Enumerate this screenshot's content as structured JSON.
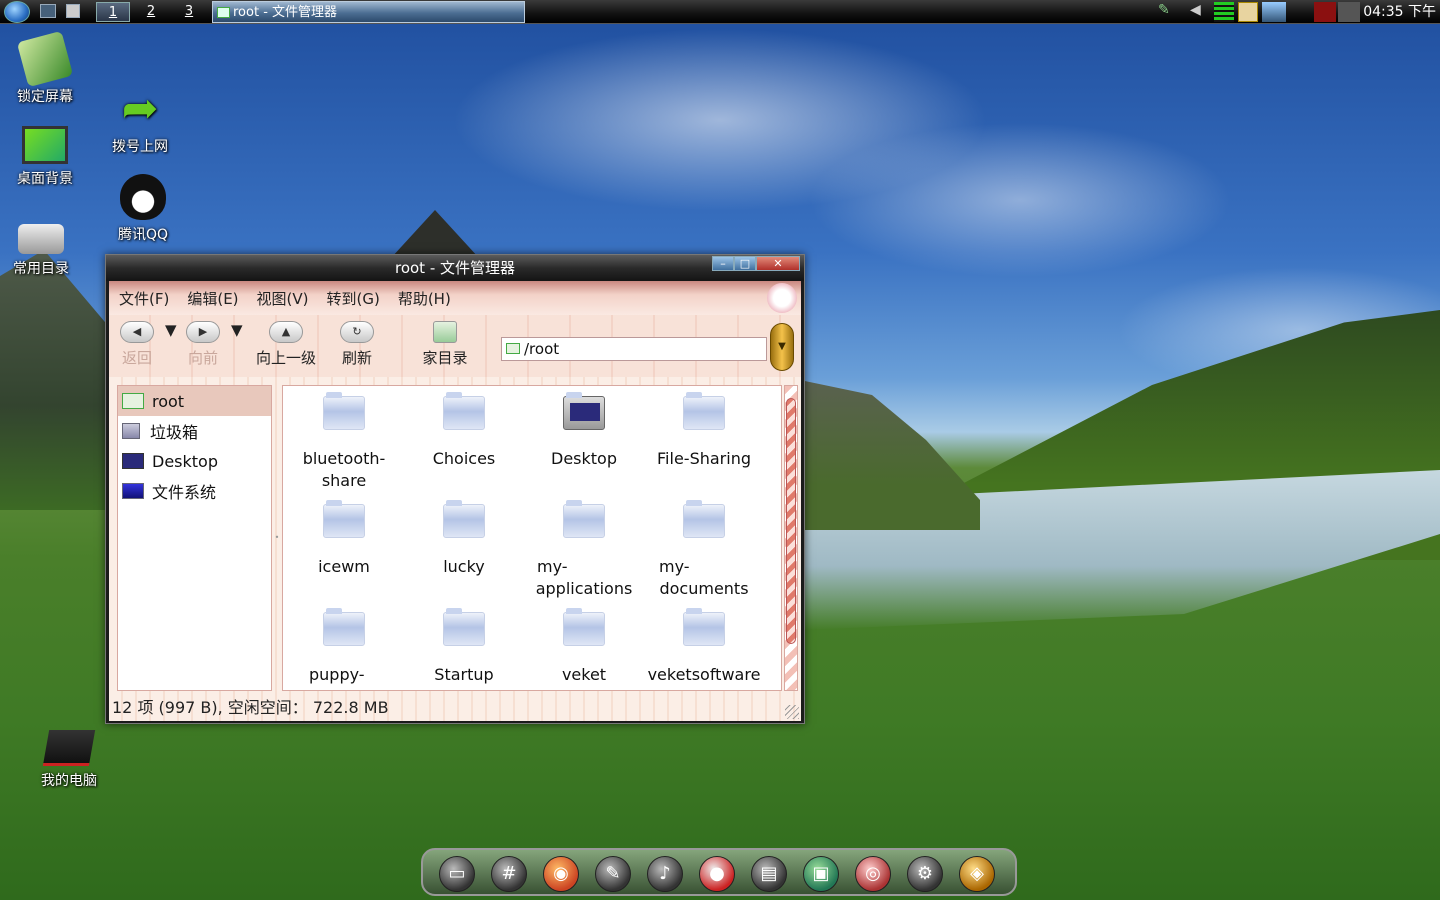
{
  "taskbar": {
    "workspaces": [
      "1",
      "2",
      "3"
    ],
    "task_title": "root - 文件管理器",
    "clock": "04:35 下午"
  },
  "desktop_icons": {
    "lock_screen": "锁定屏幕",
    "dial_up": "拨号上网",
    "wallpaper": "桌面背景",
    "qq": "腾讯QQ",
    "common_dirs": "常用目录",
    "my_computer": "我的电脑"
  },
  "window": {
    "title": "root - 文件管理器",
    "menu": [
      "文件(F)",
      "编辑(E)",
      "视图(V)",
      "转到(G)",
      "帮助(H)"
    ],
    "toolbar": {
      "back": "返回",
      "forward": "向前",
      "up": "向上一级",
      "refresh": "刷新",
      "home": "家目录"
    },
    "location": "/root",
    "sidebar": [
      "root",
      "垃圾箱",
      "Desktop",
      "文件系统"
    ],
    "files": [
      [
        "bluetooth-",
        "share"
      ],
      [
        "Choices"
      ],
      [
        "Desktop"
      ],
      [
        "File-Sharing"
      ],
      [
        "icewm"
      ],
      [
        "lucky"
      ],
      [
        "my-",
        "applications"
      ],
      [
        "my-",
        "documents"
      ],
      [
        "puppy-"
      ],
      [
        "Startup"
      ],
      [
        "veket"
      ],
      [
        "veketsoftware"
      ]
    ],
    "status": "12 项 (997 B), 空闲空间： 722.8 MB"
  },
  "colors": {
    "menubar_top": "#c98780",
    "window_pink": "#fbeee6",
    "selection": "#e8c8bc",
    "scroll_accent": "#e07a6a"
  },
  "icons": {
    "dock": [
      "file-manager-icon",
      "terminal-icon",
      "firefox-icon",
      "editor-icon",
      "music-icon",
      "qq-icon",
      "media-player-icon",
      "package-icon",
      "cd-burner-icon",
      "settings-icon",
      "media-center-icon"
    ]
  }
}
